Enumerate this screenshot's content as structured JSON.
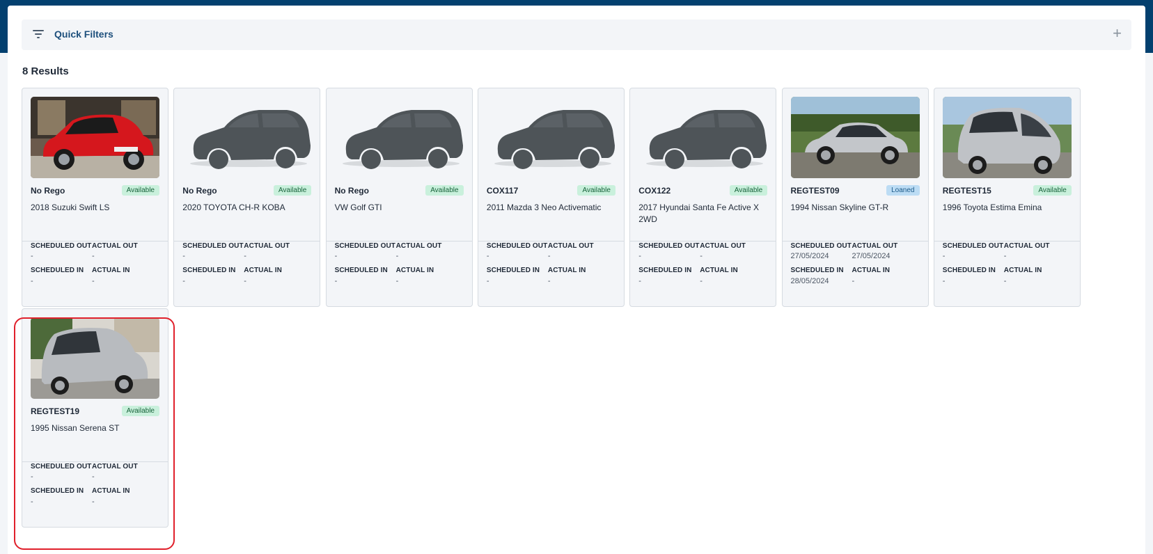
{
  "quick_filters": {
    "label": "Quick Filters",
    "expand_icon": "plus-icon",
    "filter_icon": "filter-icon"
  },
  "results": {
    "count_label": "8 Results"
  },
  "field_labels": {
    "scheduled_out": "SCHEDULED OUT",
    "actual_out": "ACTUAL OUT",
    "scheduled_in": "SCHEDULED IN",
    "actual_in": "ACTUAL IN"
  },
  "cards": [
    {
      "rego": "No Rego",
      "status": "Available",
      "title": "2018 Suzuki Swift LS",
      "scheduled_out": "-",
      "actual_out": "-",
      "scheduled_in": "-",
      "actual_in": "-",
      "photo": "red-hatchback"
    },
    {
      "rego": "No Rego",
      "status": "Available",
      "title": "2020 TOYOTA CH-R KOBA",
      "scheduled_out": "-",
      "actual_out": "-",
      "scheduled_in": "-",
      "actual_in": "-",
      "photo": "placeholder-car-silhouette"
    },
    {
      "rego": "No Rego",
      "status": "Available",
      "title": "VW Golf GTI",
      "scheduled_out": "-",
      "actual_out": "-",
      "scheduled_in": "-",
      "actual_in": "-",
      "photo": "placeholder-car-silhouette"
    },
    {
      "rego": "COX117",
      "status": "Available",
      "title": "2011 Mazda 3 Neo Activematic",
      "scheduled_out": "-",
      "actual_out": "-",
      "scheduled_in": "-",
      "actual_in": "-",
      "photo": "placeholder-car-silhouette"
    },
    {
      "rego": "COX122",
      "status": "Available",
      "title": "2017 Hyundai Santa Fe Active X 2WD",
      "scheduled_out": "-",
      "actual_out": "-",
      "scheduled_in": "-",
      "actual_in": "-",
      "photo": "placeholder-car-silhouette"
    },
    {
      "rego": "REGTEST09",
      "status": "Loaned",
      "title": "1994 Nissan Skyline GT-R",
      "scheduled_out": "27/05/2024",
      "actual_out": "27/05/2024",
      "scheduled_in": "28/05/2024",
      "actual_in": "-",
      "photo": "silver-coupe"
    },
    {
      "rego": "REGTEST15",
      "status": "Available",
      "title": "1996 Toyota Estima Emina",
      "scheduled_out": "-",
      "actual_out": "-",
      "scheduled_in": "-",
      "actual_in": "-",
      "photo": "silver-van"
    },
    {
      "rego": "REGTEST19",
      "status": "Available",
      "title": "1995 Nissan Serena ST",
      "scheduled_out": "-",
      "actual_out": "-",
      "scheduled_in": "-",
      "actual_in": "-",
      "photo": "silver-minivan"
    }
  ],
  "colors": {
    "header": "#03406f",
    "available_badge_bg": "#c9f0dc",
    "loaned_badge_bg": "#bcdcf4",
    "selection_outline": "#e0202b"
  }
}
